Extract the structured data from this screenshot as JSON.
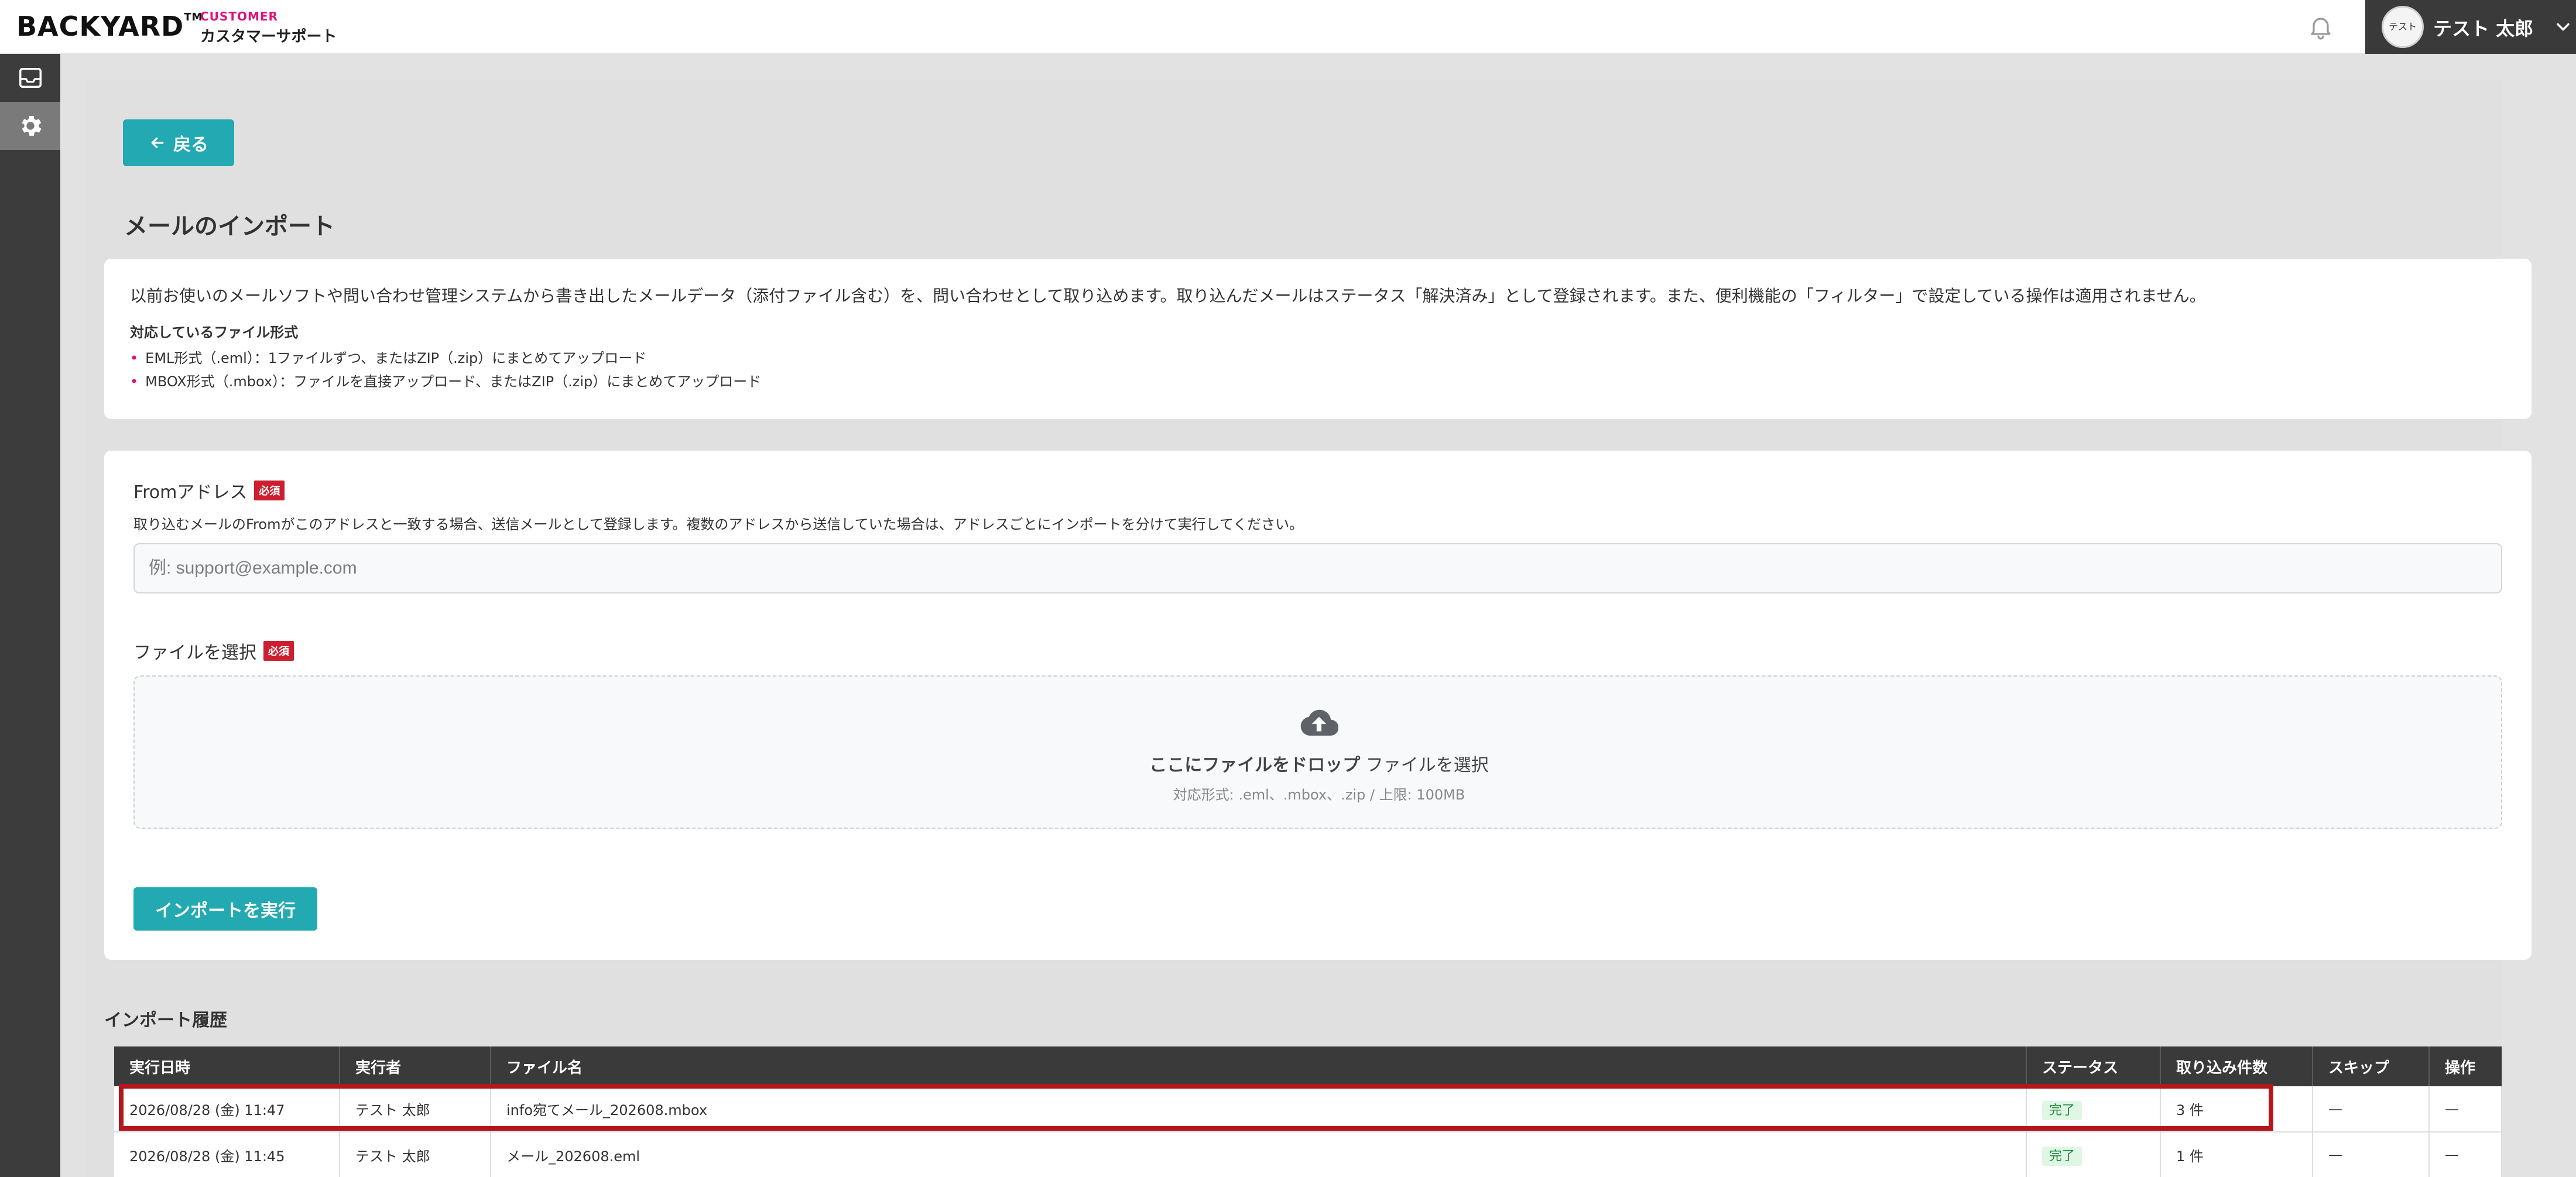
{
  "header": {
    "logo": "BACKYARD",
    "logo_tm": "TM",
    "logo_customer": "CUSTOMER",
    "logo_subtitle": "カスタマーサポート",
    "user_avatar_text": "テスト",
    "user_name": "テスト 太郎"
  },
  "sidebar": {
    "items": [
      {
        "icon": "inbox-icon"
      },
      {
        "icon": "gear-icon",
        "active": true
      }
    ]
  },
  "page": {
    "back_label": "戻る",
    "title": "メールのインポート"
  },
  "info": {
    "description": "以前お使いのメールソフトや問い合わせ管理システムから書き出したメールデータ（添付ファイル含む）を、問い合わせとして取り込めます。取り込んだメールはステータス「解決済み」として登録されます。また、便利機能の「フィルター」で設定している操作は適用されません。",
    "formats_title": "対応しているファイル形式",
    "formats": [
      "EML形式（.eml）：1ファイルずつ、またはZIP（.zip）にまとめてアップロード",
      "MBOX形式（.mbox）：ファイルを直接アップロード、またはZIP（.zip）にまとめてアップロード"
    ]
  },
  "form": {
    "from_label": "Fromアドレス",
    "required_badge": "必須",
    "from_help": "取り込むメールのFromがこのアドレスと一致する場合、送信メールとして登録します。複数のアドレスから送信していた場合は、アドレスごとにインポートを分けて実行してください。",
    "from_placeholder": "例: support@example.com",
    "from_value": "",
    "file_label": "ファイルを選択",
    "drop_main_bold": "ここにファイルをドロップ",
    "drop_main_rest": "ファイルを選択",
    "drop_sub": "対応形式: .eml、.mbox、.zip / 上限: 100MB",
    "import_button": "インポートを実行"
  },
  "history": {
    "title": "インポート履歴",
    "columns": [
      "実行日時",
      "実行者",
      "ファイル名",
      "ステータス",
      "取り込み件数",
      "スキップ",
      "操作"
    ],
    "rows": [
      {
        "datetime": "2026/08/28 (金) 11:47",
        "user": "テスト 太郎",
        "filename": "info宛てメール_202608.mbox",
        "status": "完了",
        "count": "3 件",
        "skip": "—",
        "action": "—"
      },
      {
        "datetime": "2026/08/28 (金) 11:45",
        "user": "テスト 太郎",
        "filename": "メール_202608.eml",
        "status": "完了",
        "count": "1 件",
        "skip": "—",
        "action": "—"
      }
    ]
  },
  "colors": {
    "accent": "#23a9b2",
    "brand_pink": "#e0117a",
    "required_red": "#cc1f2f",
    "highlight_red": "#b3161c"
  }
}
